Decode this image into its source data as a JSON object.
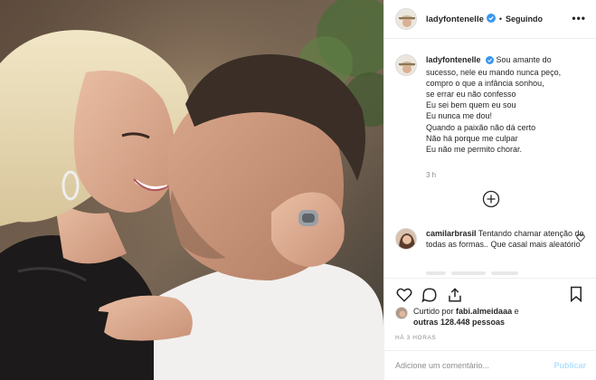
{
  "header": {
    "username": "ladyfontenelle",
    "separator": "•",
    "follow_status": "Seguindo",
    "more_label": "•••"
  },
  "caption": {
    "username": "ladyfontenelle",
    "lines": [
      "Sou amante do",
      "sucesso, nele eu mando nunca peço,",
      "compro o que a infância sonhou,",
      "se errar eu não confesso",
      "Eu sei bem quem eu sou",
      "Eu nunca me dou!",
      "Quando a paixão não dá certo",
      "Não há porque me culpar",
      "Eu não me permito chorar."
    ],
    "time": "3 h"
  },
  "comment": {
    "username": "camilarbrasil",
    "text": "Tentando chamar atenção de todas as formas.. Que casal mais aleatório"
  },
  "likes": {
    "prefix": "Curtido por",
    "first_user": "fabi.almeidaaa",
    "connector": "e",
    "others": "outras 128.448 pessoas"
  },
  "timestamp": "HÁ 3 HORAS",
  "add_comment": {
    "placeholder": "Adicione um comentário...",
    "publish_label": "Publicar"
  },
  "colors": {
    "verified": "#3897f0",
    "publish_disabled": "#b2dffc",
    "secondary_text": "#8e8e8e",
    "border": "#efefef"
  }
}
